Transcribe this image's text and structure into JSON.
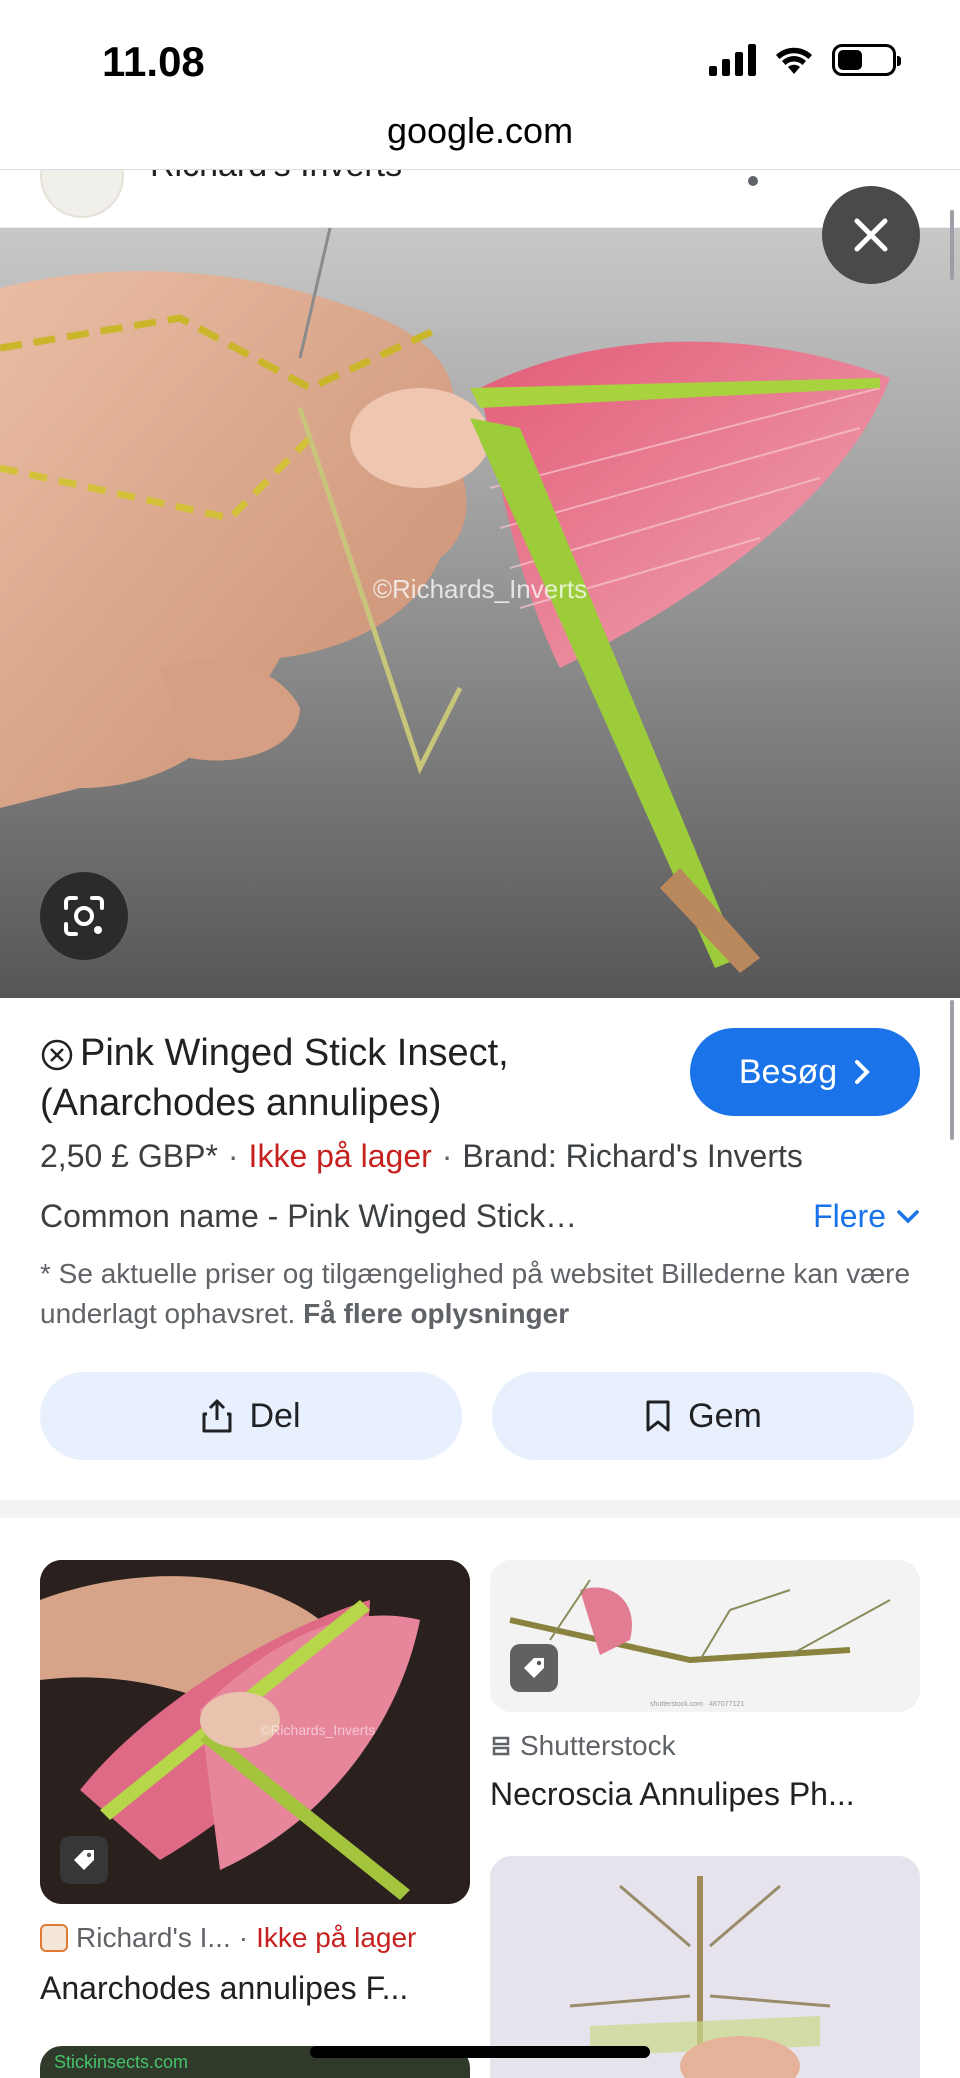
{
  "status_bar": {
    "time": "11.08"
  },
  "browser": {
    "url": "google.com"
  },
  "source_header": {
    "name": "Richard's Inverts"
  },
  "image": {
    "watermark": "©Richards_Inverts"
  },
  "product": {
    "title": "Pink Winged Stick Insect, (Anarchodes annulipes)",
    "visit_label": "Besøg",
    "price": "2,50 £ GBP*",
    "stock_status": "Ikke på lager",
    "brand": "Brand: Richard's Inverts",
    "description": "Common name - Pink Winged Stick…",
    "more_label": "Flere",
    "disclaimer": "* Se aktuelle priser og tilgængelighed på websitet Billederne kan være underlagt ophavsret.",
    "disclaimer_link": "Få flere oplysninger",
    "share_label": "Del",
    "save_label": "Gem"
  },
  "related": [
    {
      "source": "Richard's I...",
      "stock": "Ikke på lager",
      "title": "Anarchodes annulipes F...",
      "watermark": "©Richards_Inverts"
    },
    {
      "source": "Shutterstock",
      "title": "Necroscia Annulipes Ph...",
      "watermark": "shutterstock.com · 487077121"
    },
    {
      "source": "",
      "title": "",
      "watermark": "Stickinsects.com"
    }
  ],
  "colors": {
    "accent": "#1a73e8",
    "stock_red": "#c5221f",
    "button_bg": "#e8f0fe",
    "wing_pink": "#e8798f",
    "body_green": "#9ccc3a"
  }
}
